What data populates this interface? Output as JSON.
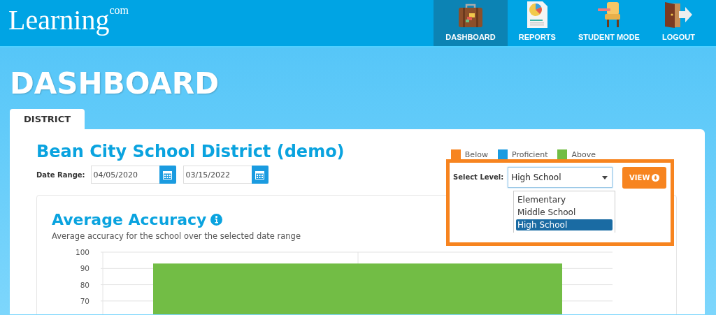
{
  "header": {
    "logo": "Learning",
    "logo_suffix": "com",
    "nav": [
      {
        "label": "DASHBOARD",
        "selected": true
      },
      {
        "label": "REPORTS",
        "selected": false
      },
      {
        "label": "STUDENT MODE",
        "selected": false
      },
      {
        "label": "LOGOUT",
        "selected": false
      }
    ]
  },
  "page_title": "DASHBOARD",
  "tabs": [
    {
      "label": "DISTRICT",
      "selected": true
    }
  ],
  "district": {
    "name": "Bean City School District (demo)",
    "date_range_label": "Date Range:",
    "start_date": "04/05/2020",
    "end_date": "03/15/2022"
  },
  "legend": [
    {
      "label": "Below",
      "color": "#f7841f"
    },
    {
      "label": "Proficient",
      "color": "#1a9be0"
    },
    {
      "label": "Above",
      "color": "#72bd45"
    }
  ],
  "level_select": {
    "label": "Select Level:",
    "value": "High School",
    "button": "VIEW",
    "options": [
      {
        "label": "Elementary",
        "selected": false
      },
      {
        "label": "Middle School",
        "selected": false
      },
      {
        "label": "High School",
        "selected": true
      }
    ]
  },
  "accuracy": {
    "title": "Average Accuracy",
    "subtitle": "Average accuracy for the school over the selected date range",
    "chart_data": {
      "type": "bar",
      "values": [
        93
      ],
      "ylim": [
        0,
        100
      ],
      "yticks": [
        70,
        80,
        90,
        100
      ],
      "grid": true
    }
  }
}
